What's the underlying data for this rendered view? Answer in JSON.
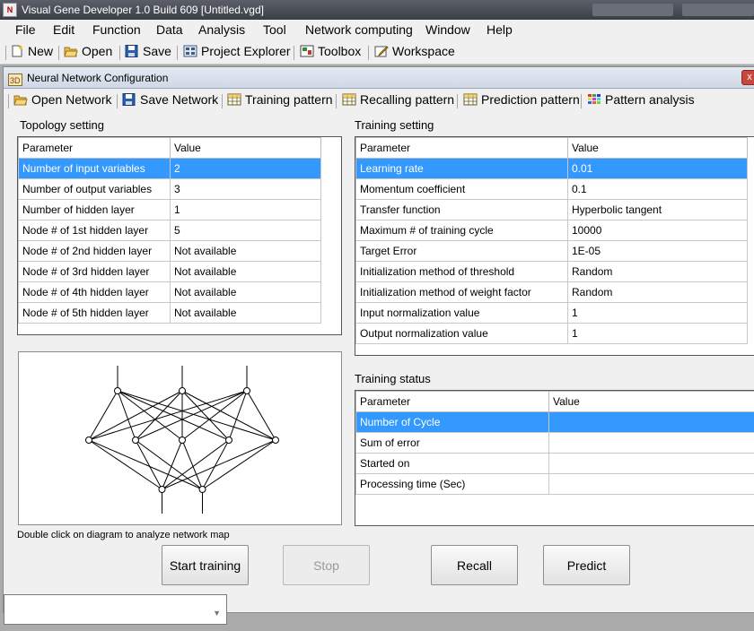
{
  "app": {
    "title": "Visual Gene Developer 1.0 Build 609    [Untitled.vgd]",
    "icon_text": "N"
  },
  "menu": [
    "File",
    "Edit",
    "Function",
    "Data",
    "Analysis",
    "Tool",
    "Network computing",
    "Window",
    "Help"
  ],
  "toolbar": {
    "new": "New",
    "open": "Open",
    "save": "Save",
    "project_explorer": "Project Explorer",
    "toolbox": "Toolbox",
    "workspace": "Workspace"
  },
  "window": {
    "title": "Neural Network Configuration",
    "close": "x",
    "toolbar": {
      "open_network": "Open Network",
      "save_network": "Save Network",
      "training_pattern": "Training pattern",
      "recalling_pattern": "Recalling pattern",
      "prediction_pattern": "Prediction pattern",
      "pattern_analysis": "Pattern analysis"
    }
  },
  "topology": {
    "label": "Topology setting",
    "headers": [
      "Parameter",
      "Value"
    ],
    "rows": [
      {
        "param": "Number of input variables",
        "value": "2"
      },
      {
        "param": "Number of output variables",
        "value": "3"
      },
      {
        "param": "Number of hidden layer",
        "value": "1"
      },
      {
        "param": "Node # of 1st hidden layer",
        "value": "5"
      },
      {
        "param": "Node # of 2nd hidden layer",
        "value": "Not available"
      },
      {
        "param": "Node # of 3rd hidden layer",
        "value": "Not available"
      },
      {
        "param": "Node # of 4th hidden layer",
        "value": "Not available"
      },
      {
        "param": "Node # of 5th hidden layer",
        "value": "Not available"
      }
    ]
  },
  "training_setting": {
    "label": "Training setting",
    "headers": [
      "Parameter",
      "Value"
    ],
    "rows": [
      {
        "param": "Learning rate",
        "value": "0.01"
      },
      {
        "param": "Momentum coefficient",
        "value": "0.1"
      },
      {
        "param": "Transfer function",
        "value": "Hyperbolic tangent"
      },
      {
        "param": "Maximum # of training cycle",
        "value": "10000"
      },
      {
        "param": "Target Error",
        "value": "1E-05"
      },
      {
        "param": "Initialization method of threshold",
        "value": "Random"
      },
      {
        "param": "Initialization method of weight factor",
        "value": "Random"
      },
      {
        "param": "Input normalization value",
        "value": "1"
      },
      {
        "param": "Output normalization value",
        "value": "1"
      }
    ]
  },
  "training_status": {
    "label": "Training status",
    "headers": [
      "Parameter",
      "Value"
    ],
    "rows": [
      {
        "param": "Number of Cycle",
        "value": ""
      },
      {
        "param": "Sum of error",
        "value": ""
      },
      {
        "param": "Started on",
        "value": ""
      },
      {
        "param": "Processing time (Sec)",
        "value": ""
      }
    ]
  },
  "diagram": {
    "hint": "Double click on diagram to analyze network map",
    "layers": [
      3,
      5,
      2
    ]
  },
  "buttons": {
    "start_training": "Start training",
    "stop": "Stop",
    "recall": "Recall",
    "predict": "Predict"
  },
  "colors": {
    "selection": "#3399ff"
  }
}
